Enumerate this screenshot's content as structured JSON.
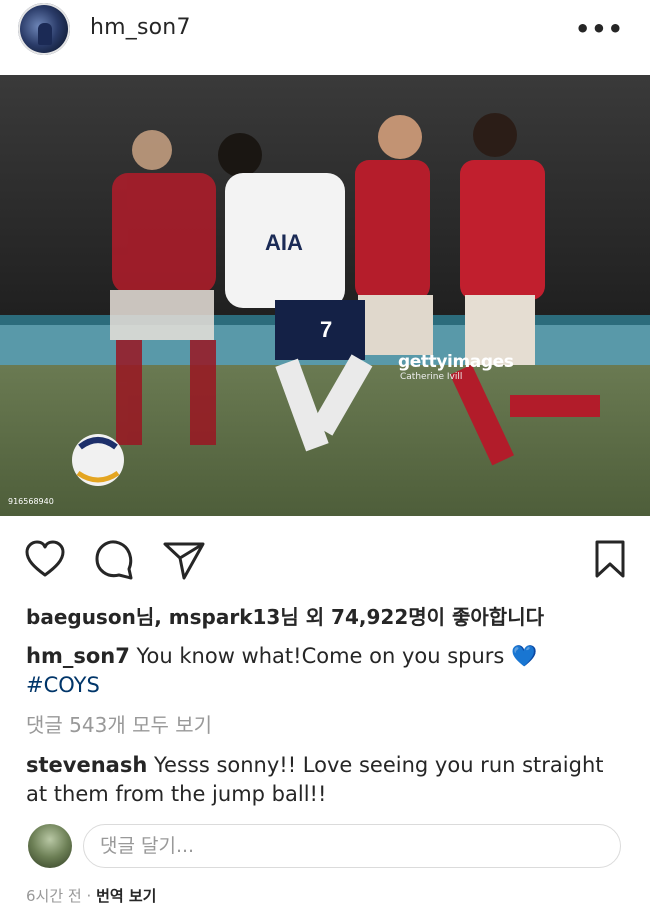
{
  "header": {
    "username": "hm_son7",
    "more_icon": "more-horizontal-icon"
  },
  "photo": {
    "watermark": "gettyimages",
    "credit": "Catherine Ivill",
    "image_id": "916568940",
    "jersey_number": "7",
    "sponsor": "AIA"
  },
  "actions": {
    "like_icon": "heart-icon",
    "comment_icon": "comment-bubble-icon",
    "share_icon": "paper-plane-icon",
    "save_icon": "bookmark-icon"
  },
  "likes": {
    "text": "baeguson님, mspark13님 외 74,922명이 좋아합니다"
  },
  "caption": {
    "username": "hm_son7",
    "text": "You know what!Come on you spurs",
    "emoji": "💙",
    "hashtag": "#COYS"
  },
  "view_all": "댓글 543개 모두 보기",
  "top_comment": {
    "username": "stevenash",
    "text": "Yesss sonny!! Love seeing you run straight at them from the jump ball!!"
  },
  "comment_box": {
    "placeholder": "댓글 달기..."
  },
  "footer": {
    "time": "6시간 전",
    "separator": "·",
    "translate": "번역 보기"
  }
}
